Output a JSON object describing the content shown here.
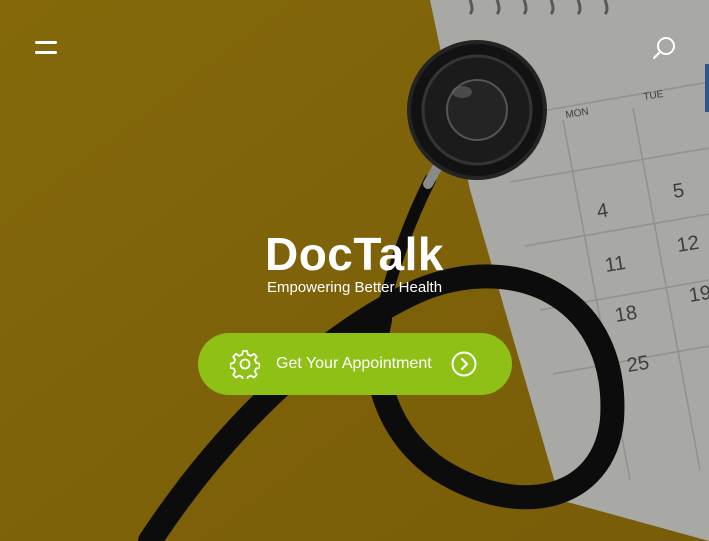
{
  "header": {
    "menu_icon": "hamburger-menu-icon",
    "search_icon": "search-icon"
  },
  "hero": {
    "title": "DocTalk",
    "tagline": "Empowering Better Health",
    "cta_label": "Get Your Appointment",
    "cta_icon": "gear-icon",
    "cta_arrow_icon": "chevron-right-circle-icon",
    "calendar": {
      "day_headers": [
        "MON",
        "TUE"
      ],
      "dates": [
        "4",
        "5",
        "11",
        "12",
        "18",
        "19",
        "25"
      ]
    }
  },
  "colors": {
    "background": "#b8900f",
    "cta": "#8fc016",
    "text": "#ffffff"
  }
}
